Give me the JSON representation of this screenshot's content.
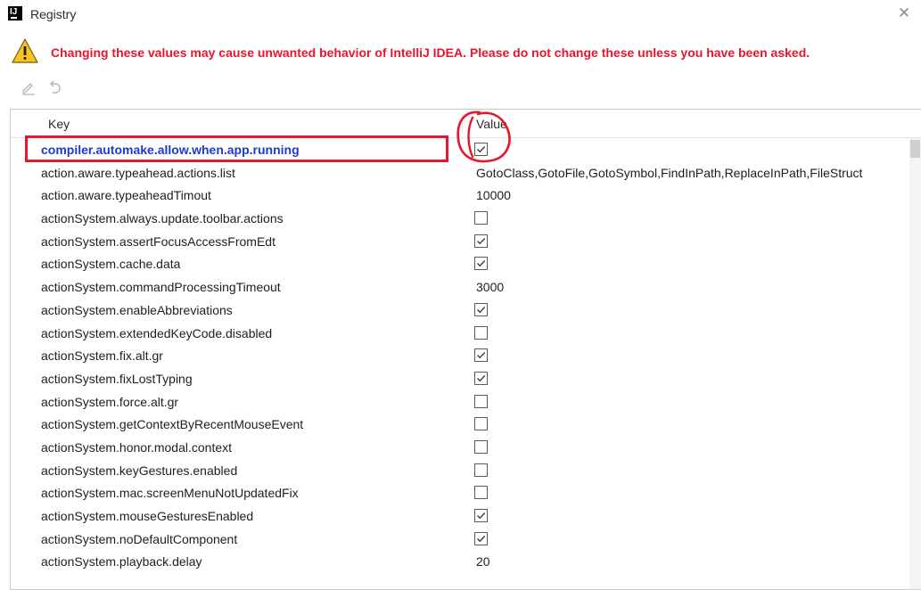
{
  "window": {
    "title": "Registry",
    "app_icon_text": "IJ",
    "close_glyph": "✕"
  },
  "warning": {
    "icon": "warning-triangle-icon",
    "text": "Changing these values may cause unwanted behavior of IntelliJ IDEA. Please do not change these unless you have been asked.",
    "color": "#e8152b"
  },
  "toolbar": {
    "edit_icon": "edit-pencil-icon",
    "revert_icon": "revert-undo-icon"
  },
  "table": {
    "columns": {
      "key": "Key",
      "value": "Value"
    },
    "rows": [
      {
        "key": "compiler.automake.allow.when.app.running",
        "type": "checkbox",
        "checked": true,
        "selected": true
      },
      {
        "key": "action.aware.typeahead.actions.list",
        "type": "text",
        "value": "GotoClass,GotoFile,GotoSymbol,FindInPath,ReplaceInPath,FileStruct"
      },
      {
        "key": "action.aware.typeaheadTimout",
        "type": "text",
        "value": "10000"
      },
      {
        "key": "actionSystem.always.update.toolbar.actions",
        "type": "checkbox",
        "checked": false
      },
      {
        "key": "actionSystem.assertFocusAccessFromEdt",
        "type": "checkbox",
        "checked": true
      },
      {
        "key": "actionSystem.cache.data",
        "type": "checkbox",
        "checked": true
      },
      {
        "key": "actionSystem.commandProcessingTimeout",
        "type": "text",
        "value": "3000"
      },
      {
        "key": "actionSystem.enableAbbreviations",
        "type": "checkbox",
        "checked": true
      },
      {
        "key": "actionSystem.extendedKeyCode.disabled",
        "type": "checkbox",
        "checked": false
      },
      {
        "key": "actionSystem.fix.alt.gr",
        "type": "checkbox",
        "checked": true
      },
      {
        "key": "actionSystem.fixLostTyping",
        "type": "checkbox",
        "checked": true
      },
      {
        "key": "actionSystem.force.alt.gr",
        "type": "checkbox",
        "checked": false
      },
      {
        "key": "actionSystem.getContextByRecentMouseEvent",
        "type": "checkbox",
        "checked": false
      },
      {
        "key": "actionSystem.honor.modal.context",
        "type": "checkbox",
        "checked": false
      },
      {
        "key": "actionSystem.keyGestures.enabled",
        "type": "checkbox",
        "checked": false
      },
      {
        "key": "actionSystem.mac.screenMenuNotUpdatedFix",
        "type": "checkbox",
        "checked": false
      },
      {
        "key": "actionSystem.mouseGesturesEnabled",
        "type": "checkbox",
        "checked": true
      },
      {
        "key": "actionSystem.noDefaultComponent",
        "type": "checkbox",
        "checked": true
      },
      {
        "key": "actionSystem.playback.delay",
        "type": "text",
        "value": "20"
      }
    ]
  },
  "colors": {
    "selected_key": "#1a3ad4",
    "annotation": "#e8152b"
  }
}
